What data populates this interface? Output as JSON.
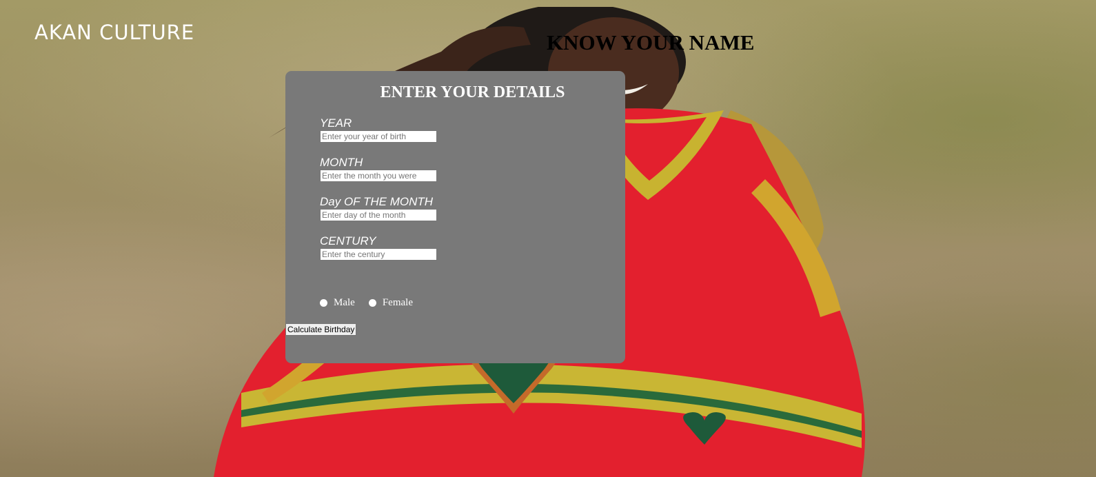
{
  "header": {
    "brand": "AKAN CULTURE",
    "headline": "KNOW YOUR NAME"
  },
  "form": {
    "title": "ENTER YOUR DETAILS",
    "fields": [
      {
        "label": "YEAR",
        "placeholder": "Enter your year of birth",
        "value": ""
      },
      {
        "label": "MONTH",
        "placeholder": "Enter the month you were",
        "value": ""
      },
      {
        "label": "Day OF THE MONTH",
        "placeholder": "Enter day of the month",
        "value": ""
      },
      {
        "label": "CENTURY",
        "placeholder": "Enter the century",
        "value": ""
      }
    ],
    "gender_options": [
      {
        "label": "Male",
        "selected": false
      },
      {
        "label": "Female",
        "selected": false
      }
    ],
    "submit_label": "Calculate Birthday"
  },
  "colors": {
    "card_background": "#797979",
    "dress_red": "#e3202e",
    "heart_green": "#1e5a3a"
  },
  "background_image": "woman-in-red-kitenge-dress-on-grass"
}
